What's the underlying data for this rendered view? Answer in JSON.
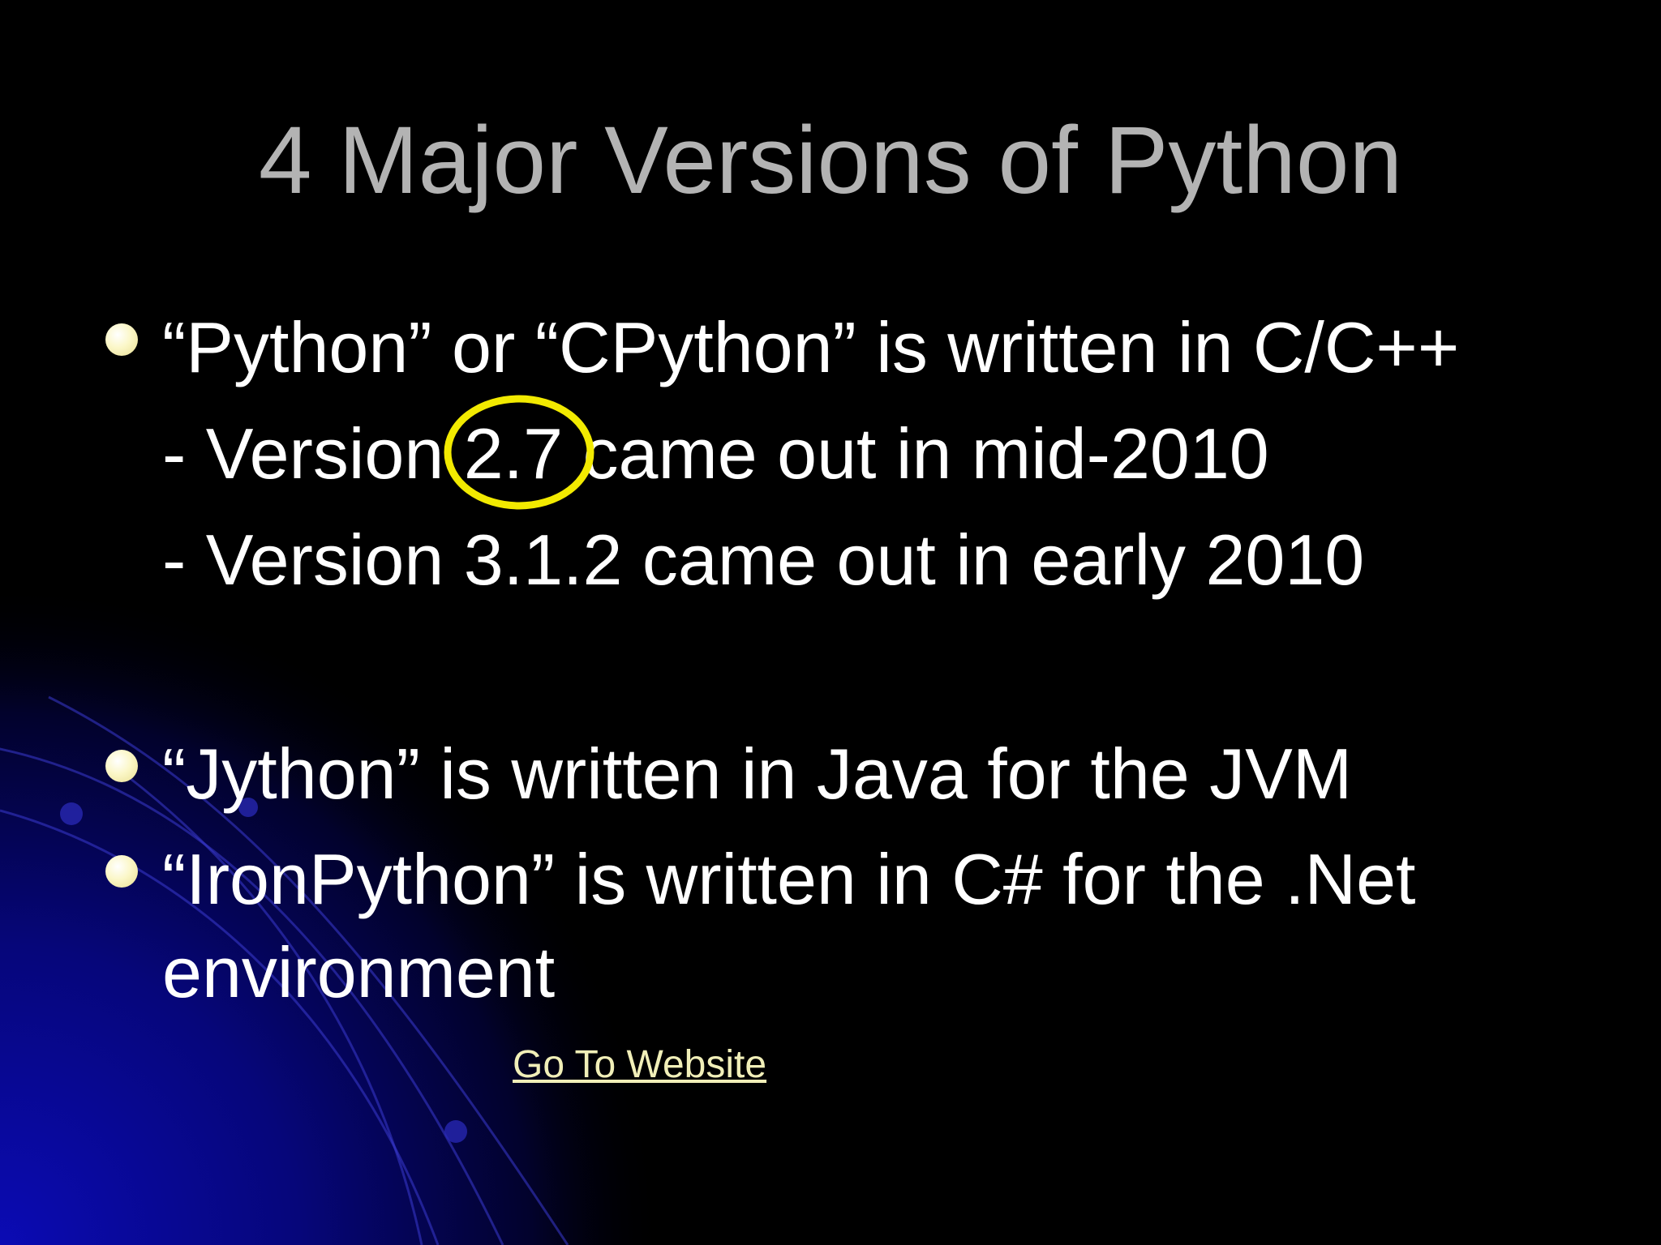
{
  "slide": {
    "title": "4 Major Versions of Python",
    "bullets": [
      {
        "text": "“Python” or “CPython” is written in C/C++",
        "sub_items": [
          "- Version 2.7 came out in mid-2010",
          "- Version 3.1.2 came out in early 2010"
        ]
      },
      {
        "text": "“Jython” is written in Java for the JVM"
      },
      {
        "text": "“IronPython” is written in C# for the .Net",
        "continuation": "environment"
      }
    ],
    "link_label": "Go To Website"
  },
  "colors": {
    "background": "#000000",
    "title": "#b3b3b3",
    "body_text": "#ffffff",
    "bullet": "#fbf7c8",
    "link": "#f1efb8",
    "highlight_ring": "#f2ea00",
    "decor_blue": "#0a0aa8"
  },
  "icons": {
    "bullet": "bullet-dot-icon",
    "highlight": "highlight-circle-icon"
  }
}
